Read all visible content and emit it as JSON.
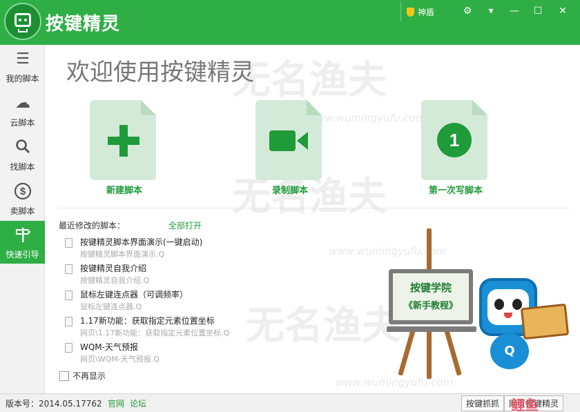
{
  "app": {
    "title": "按键精灵",
    "shield_label": "神盾",
    "window_controls": [
      "⚙",
      "▾",
      "—",
      "☐",
      "✕"
    ]
  },
  "sidebar": {
    "items": [
      {
        "label": "我的脚本",
        "icon": "list-icon"
      },
      {
        "label": "云脚本",
        "icon": "cloud-icon"
      },
      {
        "label": "找脚本",
        "icon": "search-icon"
      },
      {
        "label": "卖脚本",
        "icon": "dollar-icon"
      },
      {
        "label": "快速引导",
        "icon": "signpost-icon"
      }
    ]
  },
  "main": {
    "welcome": "欢迎使用按键精灵",
    "actions": [
      {
        "label": "新建脚本",
        "icon": "plus-icon"
      },
      {
        "label": "录制脚本",
        "icon": "video-camera-icon"
      },
      {
        "label": "第一次写脚本",
        "icon": "number-one-icon",
        "icon_text": "1"
      }
    ],
    "recent_label": "最近修改的脚本：",
    "open_all": "全部打开",
    "recent": [
      {
        "name": "按键精灵脚本界面演示(一键启动)",
        "path": "按键精灵脚本界面演示.Q"
      },
      {
        "name": "按键精灵自我介绍",
        "path": "按键精灵自我介绍.Q"
      },
      {
        "name": "鼠标左键连点器（可调频率）",
        "path": "鼠标左键连点器.Q"
      },
      {
        "name": "1.17新功能：获取指定元素位置坐标",
        "path": "网页\\1.17新功能：获取指定元素位置坐标.Q"
      },
      {
        "name": "WQM-天气预报",
        "path": "网页\\WQM-天气预报.Q"
      }
    ],
    "no_more": "不再显示",
    "academy_title": "按键学院",
    "academy_subtitle": "《新手教程》",
    "mascot_letter": "Q"
  },
  "watermark": {
    "text": "无名渔夫",
    "url": "www.wumingyufu.com"
  },
  "footer": {
    "version": "版本号：2014.05.17762",
    "links": [
      "官网",
      "论坛"
    ],
    "tabs": [
      "按键抓抓",
      "网页按键精灵"
    ],
    "brand": "鲤鱼"
  },
  "colors": {
    "brand_green": "#2fae46",
    "link_green": "#1f9b3a",
    "card_bg": "#d4ead8"
  }
}
